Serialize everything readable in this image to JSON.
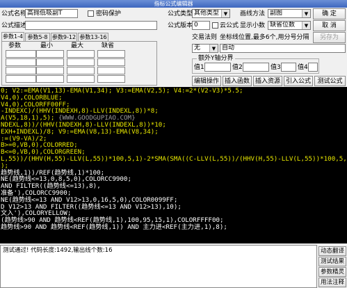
{
  "window": {
    "title": "指标公式编辑器"
  },
  "form": {
    "name_label": "公式名称",
    "name_value": "高抛低吸副T",
    "password_label": "密码保护",
    "desc_label": "公式描述",
    "type_label": "公式类型",
    "type_value": "其他类型",
    "draw_label": "画线方法",
    "draw_value": "副图",
    "version_label": "公式版本",
    "version_value": "0",
    "cloud_label": "云公式",
    "decimals_label": "显示小数",
    "decimals_value": "缺省位数"
  },
  "buttons": {
    "ok": "确  定",
    "cancel": "取  消",
    "save_as": "另存为",
    "edit_ops": "编辑操作",
    "insert_func": "插入函数",
    "insert_res": "插入资源",
    "import_formula": "引入公式",
    "test_formula": "测试公式"
  },
  "tabs": [
    "参数1-4",
    "参数5-8",
    "参数9-12",
    "参数13-16"
  ],
  "param_headers": [
    "参数",
    "最小",
    "最大",
    "缺省"
  ],
  "trade": {
    "label": "交易法则",
    "hint": "坐标线位置,最多6个,用分号分隔",
    "rule_value": "无",
    "coord_value": "自动"
  },
  "extra": {
    "title": "额外Y轴分界",
    "labels": [
      "值1",
      "值2",
      "值3",
      "值4"
    ]
  },
  "code_lines": [
    [
      {
        "c": "c-y",
        "t": "0; V2:=EMA(V1,13)-EMA(V1,34); V3:=EMA(V2,5); V4:=2*(V2-V3)*5.5;"
      }
    ],
    [
      {
        "c": "c-y",
        "t": "V4,0),COLORBLUE;"
      }
    ],
    [
      {
        "c": "c-y",
        "t": "V4,0),COLORFF00FF;"
      }
    ],
    [
      {
        "c": "c-y",
        "t": "-INDEXC)/(HHV(INDEXH,8)-LLV(INDEXL,8))*8;"
      }
    ],
    [
      {
        "c": "c-y",
        "t": "A(V5,18,1),5); "
      },
      {
        "c": "c-g",
        "t": "{WWW.GOODGUPIAO.COM}"
      }
    ],
    [
      {
        "c": "c-y",
        "t": "NDEXL,8))/(HHV(INDEXH,8)-LLV(INDEXL,8))*10;"
      }
    ],
    [
      {
        "c": "c-y",
        "t": "EXH+INDEXL)/8; V9:=EMA(V8,13)-EMA(V8,34);"
      }
    ],
    [
      {
        "c": "c-y",
        "t": ":=(V9-VA)/2;"
      }
    ],
    [
      {
        "c": "c-y",
        "t": "B>=0,VB,0),COLORRED;"
      }
    ],
    [
      {
        "c": "c-y",
        "t": "B<=0,VB,0),COLORGREEN;"
      }
    ],
    [
      {
        "c": "c-y",
        "t": "L,55))/(HHV(H,55)-LLV(L,55))*100,5,1)-2*SMA(SMA((C-LLV(L,55))/(HHV(H,55)-LLV(L,55))*100,5,"
      }
    ],
    [
      {
        "c": "c-y",
        "t": ");"
      }
    ],
    [
      {
        "c": "c-w",
        "t": "趋势线,1))/REF(趋势线,1)*100;"
      }
    ],
    [
      {
        "c": "c-w",
        "t": "NE(趋势线<=13,0,8,5,0),COLORCC9900;"
      }
    ],
    [
      {
        "c": "c-w",
        "t": "AND FILTER((趋势线<=13),8),"
      }
    ],
    [
      {
        "c": "c-w",
        "t": "准备'),COLORCC9900;"
      }
    ],
    [
      {
        "c": "c-w",
        "t": "NE(趋势线<=13 AND V12>13,0,16,5,0),COLOR0099FF;"
      }
    ],
    [
      {
        "c": "c-w",
        "t": "D V12>13 AND FILTER((趋势线<=13 AND V12>13),10);"
      }
    ],
    [
      {
        "c": "c-w",
        "t": "文入'),COLORYELLOW;"
      }
    ],
    [
      {
        "c": "c-w",
        "t": "(趋势线>90 AND 趋势线<REF(趋势线,1),100,95,15,1),COLORFFFF00;"
      }
    ],
    [
      {
        "c": "c-w",
        "t": "趋势线>90 AND 趋势线<REF(趋势线,1)) AND 主力进<REF(主力进,1),8);"
      }
    ]
  ],
  "status": {
    "text": "测试通过! 代码长度:1492,输出线个数:16"
  },
  "side_buttons": [
    "动态翻译",
    "测试结果",
    "参数精灵",
    "用法注释"
  ]
}
